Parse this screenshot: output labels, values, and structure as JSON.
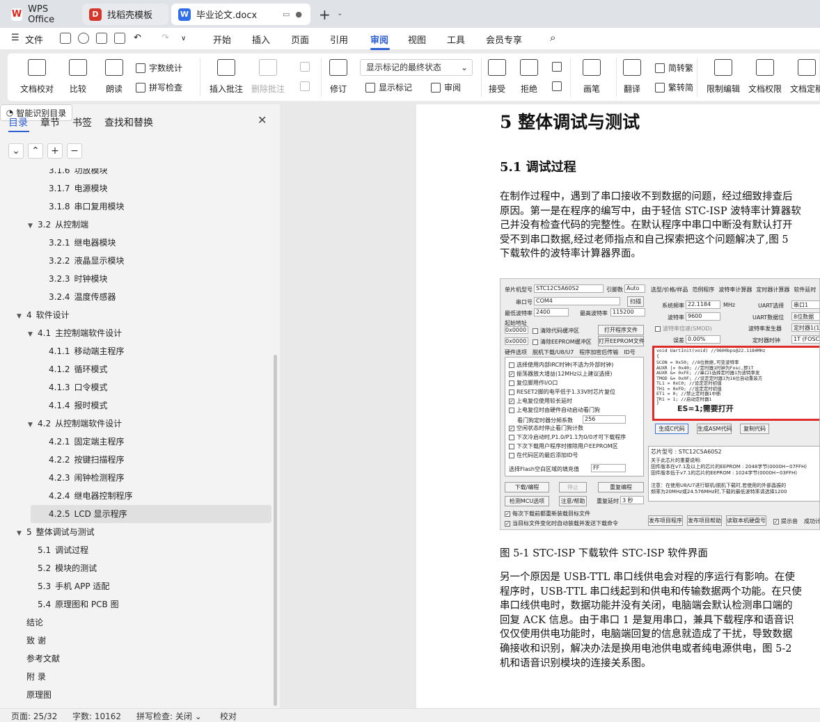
{
  "tabs": [
    {
      "label": "WPS Office"
    },
    {
      "label": "找稻壳模板"
    },
    {
      "label": "毕业论文.docx"
    }
  ],
  "menu": {
    "file": "文件",
    "items": [
      "开始",
      "插入",
      "页面",
      "引用",
      "审阅",
      "视图",
      "工具",
      "会员专享"
    ],
    "active": "审阅"
  },
  "ribbon": {
    "doc_proof": "文档校对",
    "compare": "比较",
    "read_aloud": "朗读",
    "word_count": "字数统计",
    "spell_check": "拼写检查",
    "insert_comment": "插入批注",
    "delete_comment": "删除批注",
    "track": "修订",
    "markup_state": "显示标记的最终状态",
    "show_markup": "显示标记",
    "review_pane": "审阅",
    "accept": "接受",
    "reject": "拒绝",
    "ink": "画笔",
    "translate": "翻译",
    "to_traditional": "简转繁",
    "to_simplified": "繁转简",
    "restrict_edit": "限制编辑",
    "doc_permission": "文档权限",
    "doc_final": "文档定稿"
  },
  "nav": {
    "tabs": [
      "目录",
      "章节",
      "书签",
      "查找和替换"
    ],
    "smart_toc": "智能识别目录",
    "toc": [
      {
        "num": "3.1.6",
        "text": "功放模块",
        "level": 3
      },
      {
        "num": "3.1.7",
        "text": "电源模块",
        "level": 3
      },
      {
        "num": "3.1.8",
        "text": "串口复用模块",
        "level": 3
      },
      {
        "num": "3.2",
        "text": "从控制端",
        "level": 2,
        "toggle": true
      },
      {
        "num": "3.2.1",
        "text": "继电器模块",
        "level": 3
      },
      {
        "num": "3.2.2",
        "text": "液晶显示模块",
        "level": 3
      },
      {
        "num": "3.2.3",
        "text": "时钟模块",
        "level": 3
      },
      {
        "num": "3.2.4",
        "text": "温度传感器",
        "level": 3
      },
      {
        "num": "4",
        "text": "软件设计",
        "level": 1,
        "toggle": true
      },
      {
        "num": "4.1",
        "text": "主控制端软件设计",
        "level": 2,
        "toggle": true
      },
      {
        "num": "4.1.1",
        "text": "移动端主程序",
        "level": 3
      },
      {
        "num": "4.1.2",
        "text": "循环模式",
        "level": 3
      },
      {
        "num": "4.1.3",
        "text": "口令模式",
        "level": 3
      },
      {
        "num": "4.1.4",
        "text": "报时模式",
        "level": 3
      },
      {
        "num": "4.2",
        "text": "从控制端软件设计",
        "level": 2,
        "toggle": true
      },
      {
        "num": "4.2.1",
        "text": "固定端主程序",
        "level": 3
      },
      {
        "num": "4.2.2",
        "text": "按键扫描程序",
        "level": 3
      },
      {
        "num": "4.2.3",
        "text": "闹钟检测程序",
        "level": 3
      },
      {
        "num": "4.2.4",
        "text": "继电器控制程序",
        "level": 3
      },
      {
        "num": "4.2.5",
        "text": "LCD 显示程序",
        "level": 3,
        "selected": true
      },
      {
        "num": "5",
        "text": "整体调试与测试",
        "level": 1,
        "toggle": true
      },
      {
        "num": "5.1",
        "text": "调试过程",
        "level": 2
      },
      {
        "num": "5.2",
        "text": "模块的测试",
        "level": 2
      },
      {
        "num": "5.3",
        "text": "手机 APP 适配",
        "level": 2
      },
      {
        "num": "5.4",
        "text": "原理图和 PCB 图",
        "level": 2
      },
      {
        "num": "",
        "text": "结论",
        "level": 1
      },
      {
        "num": "",
        "text": "致 谢",
        "level": 1
      },
      {
        "num": "",
        "text": "参考文献",
        "level": 1
      },
      {
        "num": "",
        "text": "附 录",
        "level": 1
      },
      {
        "num": "",
        "text": "原理图",
        "level": 1
      }
    ]
  },
  "doc": {
    "h1": "5  整体调试与测试",
    "h2": "5.1  调试过程",
    "p1": [
      "在制作过程中，遇到了串口接收不到数据的问题，经过细致排查后",
      "原因。第一是在程序的编写中，由于轻信 STC-ISP 波特率计算器软",
      "己并没有检查代码的完整性。在默认程序中串口中断没有默认打开",
      "受不到串口数据,经过老师指点和自己探索把这个问题解决了,图 5",
      "下载软件的波特率计算器界面。"
    ],
    "caption": "图 5-1 STC-ISP 下载软件 STC-ISP 软件界面",
    "p2": [
      "另一个原因是 USB-TTL 串口线供电会对程的序运行有影响。在使",
      "程序时，USB-TTL 串口线起到和供电和传输数据两个功能。在只使",
      "串口线供电时，数据功能并没有关闭，电脑端会默认检测串口端的",
      "回复 ACK 信息。由于串口 1 是复用串口，兼具下载程序和语音识",
      "仅仅使用供电功能时，电脑端回复的信息就造成了干扰，导致数据",
      "确接收和识别，解决办法是换用电池供电或者纯电源供电，图 5-2",
      "机和语音识别模块的连接关系图。"
    ]
  },
  "figure": {
    "mcu_label": "单片机型号",
    "mcu_value": "STC12C5A60S2",
    "pin_label": "引脚数",
    "pin_value": "Auto",
    "port_label": "串口号",
    "port_value": "COM4",
    "scan": "扫描",
    "min_baud_label": "最低波特率",
    "min_baud": "2400",
    "max_baud_label": "最高波特率",
    "max_baud": "115200",
    "start_addr": "起始地址",
    "addr1": "0x0000",
    "addr2": "0x0000",
    "clear_code": "清除代码缓冲区",
    "clear_eeprom": "清除EEPROM缓冲区",
    "open_prog": "打开程序文件",
    "open_eeprom": "打开EEPROM文件",
    "hw_tabs": [
      "硬件选项",
      "脱机下载/U8/U7",
      "程序加密后传输",
      "ID号"
    ],
    "options": [
      {
        "on": false,
        "text": "选择使用内部IRC时钟(不选为外部时钟)"
      },
      {
        "on": true,
        "text": "振荡器放大增益(12MHz以上建议选择)"
      },
      {
        "on": false,
        "text": "复位脚用作I/O口"
      },
      {
        "on": false,
        "text": "RESET2脚的电平低于1.33V时芯片复位"
      },
      {
        "on": true,
        "text": "上电复位使用较长延时"
      },
      {
        "on": false,
        "text": "上电复位时由硬件自动启动看门狗"
      },
      {
        "on": true,
        "text": "空闲状态时停止看门狗计数"
      },
      {
        "on": false,
        "text": "下次冷启动时,P1.0/P1.1为0/0才可下载程序"
      },
      {
        "on": false,
        "text": "下次下载用户程序时擦除用户EEPROM区"
      },
      {
        "on": false,
        "text": "在代码区的最后添加ID号"
      }
    ],
    "wdt_label": "看门狗定时器分频系数",
    "wdt_value": "256",
    "fill_label": "选择Flash空白区域的填充值",
    "fill_value": "FF",
    "download": "下载/编程",
    "stop": "停止",
    "reprogram": "重复编程",
    "check_mcu": "检测MCU选项",
    "help": "注意/帮助",
    "repeat_delay": "重复延时",
    "repeat_delay_value": "3 秒",
    "reload_each": "每次下载前都重新装载目标文件",
    "auto_send": "当目标文件变化时自动装载并发送下载命令",
    "right_tabs": [
      "选型/价格/样品",
      "范例程序",
      "波特率计算器",
      "定时器计算器",
      "软件延时"
    ],
    "freq_label": "系统频率",
    "freq_value": "22.1184",
    "freq_unit": "MHz",
    "baud_label": "波特率",
    "baud_value": "9600",
    "baud_double": "波特率倍速(SMOD)",
    "err_label": "误差",
    "err_value": "0.00%",
    "uart_sel_label": "UART选择",
    "uart_sel": "串口1",
    "uart_bits_label": "UART数据位",
    "uart_bits": "8位数据",
    "baud_gen_label": "波特率发生器",
    "baud_gen": "定时器1(16位自",
    "timer_clk_label": "定时器时钟",
    "timer_clk": "1T (FOSC)",
    "code_lines": [
      "void UartInit(void)        //9600bps@22.1184MHz",
      "{",
      "    SCON = 0x50;           //8位数据,可变波特率",
      "    AUXR |= 0x40;          //定时器1时钟为Fosc,即1T",
      "    AUXR &= 0xFE;          //串口1选择定时器1为波特率发",
      "    TMOD &= 0x0F;          //设定定时器1为16位自动重装方",
      "    TL1 = 0xC0;            //设定定时初值",
      "    TH1 = 0xFD;            //设定定时初值",
      "    ET1 = 0;               //禁止定时器1中断",
      "    TR1 = 1;               //启动定时器1",
      "}"
    ],
    "es_note": "ES=1;需要打开",
    "gen_c": "生成C代码",
    "gen_asm": "生成ASM代码",
    "copy_code": "复制代码",
    "chip_label": "芯片型号 : STC12C5A60S2",
    "chip_info": [
      "关于此芯片的重要说明:",
      "  固件版本在v7.1及以上的芯片的EEPROM : 2048字节(0000H~07FFH)",
      "  固件版本低于v7.1的芯片的EEPROM    : 1024字节(0000H~03FFH)",
      "",
      "注意：在使用U8/U7进行联机/脱机下载时,若使用的外部晶振的",
      "      频率为20MHz或24.576MHz时,下载的最低波特率请选择1200"
    ],
    "bottom_btns": [
      "发布项目程序",
      "发布项目帮助",
      "读取本机硬盘号"
    ],
    "hint": "提示音",
    "success": "成功计数"
  },
  "status": {
    "page": "页面: 25/32",
    "words": "字数: 10162",
    "spell": "拼写检查: 关闭",
    "proof": "校对"
  }
}
